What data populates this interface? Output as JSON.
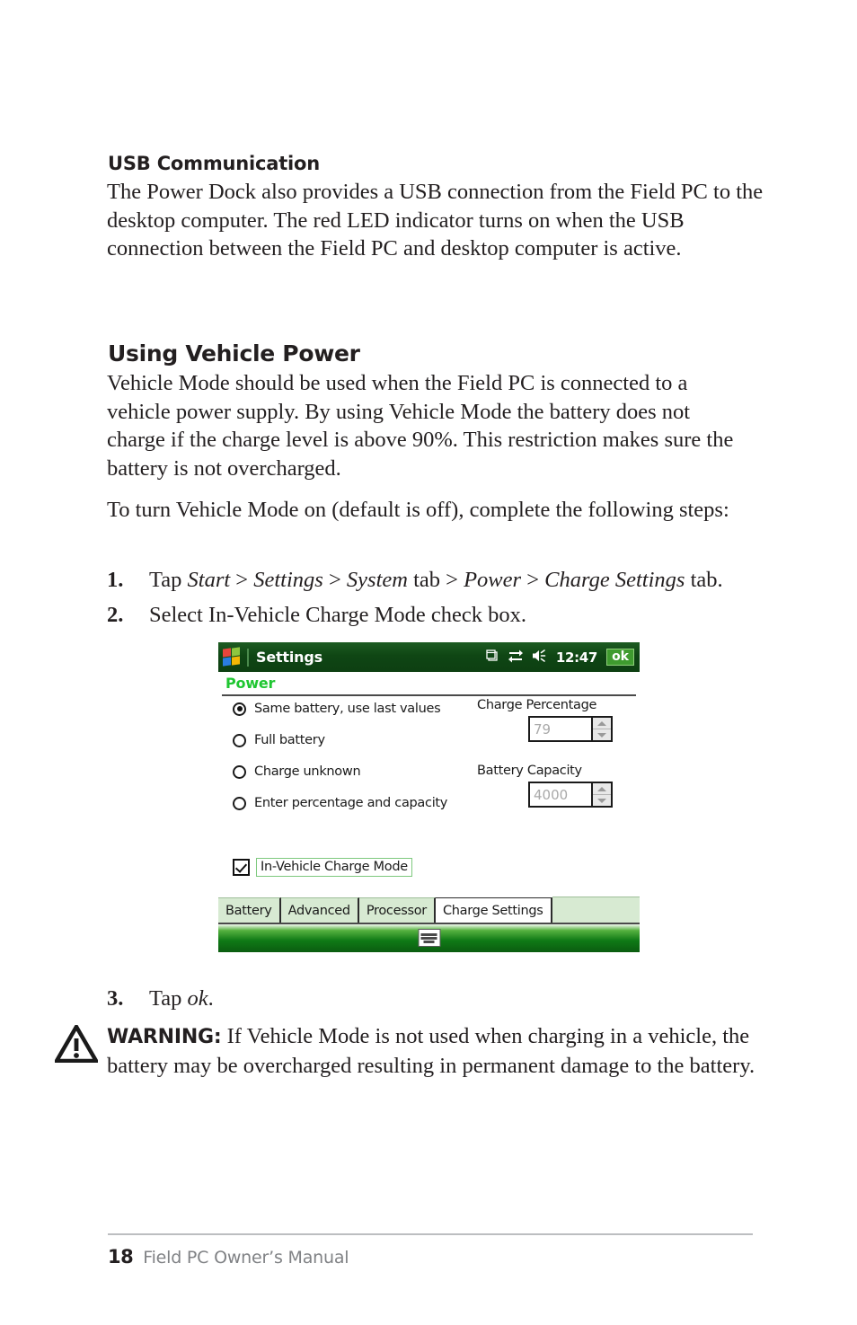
{
  "document": {
    "usb_section": {
      "heading": "USB Communication",
      "paragraph": "The Power Dock also provides a USB connection from the Field PC to the desktop computer. The red LED indicator turns on when the USB connection between the Field PC and desktop computer is active."
    },
    "vehicle_section": {
      "heading": "Using Vehicle Power",
      "paragraph": "Vehicle Mode should be used when the Field PC is connected to a vehicle power supply. By using Vehicle Mode the battery does not charge if the charge level is above 90%. This restriction makes sure the battery is not overcharged.",
      "intro": "To turn Vehicle Mode on (default is off), complete the following steps:",
      "steps": [
        {
          "number": "1.",
          "text_prefix": "Tap ",
          "italic_1": "Start",
          "sep_1": " > ",
          "italic_2": "Settings",
          "sep_2": " > ",
          "italic_3": "System",
          "sep_3": " tab > ",
          "italic_4": "Power",
          "sep_4": " > ",
          "italic_5": "Charge Settings",
          "suffix": " tab."
        },
        {
          "number": "2.",
          "text": "Select In-Vehicle Charge Mode check box."
        },
        {
          "number": "3.",
          "text_prefix": "Tap ",
          "italic_1": "ok",
          "suffix": "."
        }
      ]
    },
    "warning": {
      "icon": "warning-triangle-icon",
      "label": "WARNING:",
      "text": " If Vehicle Mode is not used when charging in a vehicle, the battery may be overcharged resulting in permanent damage to the battery."
    },
    "footer": {
      "page_number": "18",
      "manual_title": "Field PC Owner’s Manual"
    }
  },
  "device_screenshot": {
    "titlebar": {
      "start_logo": "windows-flag-icon",
      "title": "Settings",
      "icons": [
        "multitask-windows-icon",
        "connectivity-arrows-icon",
        "volume-speaker-icon"
      ],
      "time": "12:47",
      "ok_label": "ok"
    },
    "applet": {
      "title": "Power"
    },
    "radio_group": {
      "options": [
        {
          "label": "Same battery, use last values",
          "selected": true
        },
        {
          "label": "Full battery",
          "selected": false
        },
        {
          "label": "Charge unknown",
          "selected": false
        },
        {
          "label": "Enter percentage and capacity",
          "selected": false
        }
      ]
    },
    "fields": [
      {
        "label": "Charge Percentage",
        "value": "79",
        "disabled": true
      },
      {
        "label": "Battery Capacity",
        "value": "4000",
        "disabled": true
      }
    ],
    "checkbox": {
      "label": "In-Vehicle Charge Mode",
      "checked": true
    },
    "tabs": [
      {
        "label": "Battery",
        "active": false
      },
      {
        "label": "Advanced",
        "active": false
      },
      {
        "label": "Processor",
        "active": false
      },
      {
        "label": "Charge Settings",
        "active": true
      }
    ],
    "taskbar": {
      "sip_icon": "keyboard-icon"
    },
    "colors": {
      "titlebar_green": "#0f4614",
      "applet_title_green": "#1fc631",
      "tab_inactive": "#d7ead2",
      "ok_button_green": "#3f9b2f"
    }
  }
}
